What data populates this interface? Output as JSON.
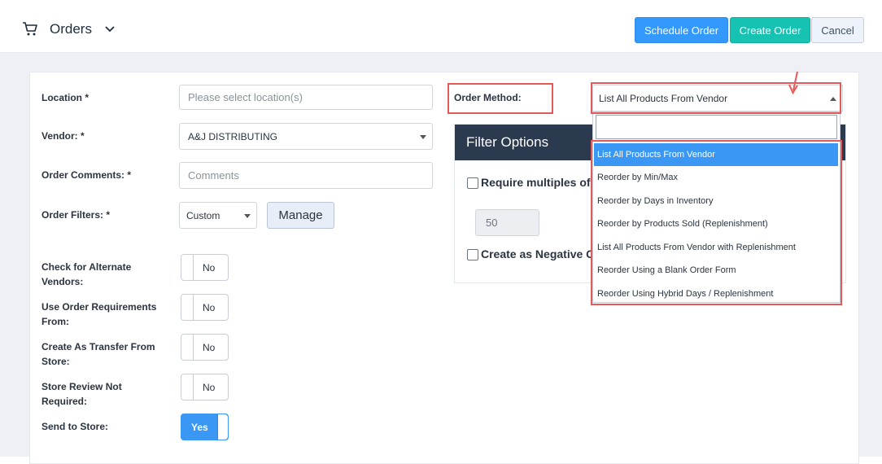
{
  "header": {
    "icon": "cart-icon",
    "title": "Orders",
    "chevron_icon": "chevron-down-icon",
    "buttons": {
      "schedule": "Schedule Order",
      "create": "Create Order",
      "cancel": "Cancel"
    },
    "colors": {
      "schedule": "#3399ff",
      "create": "#16c2b1"
    }
  },
  "form": {
    "location": {
      "label": "Location *",
      "placeholder": "Please select location(s)"
    },
    "vendor": {
      "label": "Vendor: *",
      "value": "A&J DISTRIBUTING"
    },
    "comments": {
      "label": "Order Comments: *",
      "placeholder": "Comments"
    },
    "filters": {
      "label": "Order Filters: *",
      "value": "Custom",
      "manage": "Manage"
    },
    "toggles": [
      {
        "label_1": "Check for Alternate",
        "label_2": "Vendors:",
        "value": "No"
      },
      {
        "label_1": "Use Order Requirements",
        "label_2": "From:",
        "value": "No"
      },
      {
        "label_1": "Create As Transfer From",
        "label_2": "Store:",
        "value": "No"
      },
      {
        "label_1": "Store Review Not",
        "label_2": "Required:",
        "value": "No"
      },
      {
        "label_1": "Send to Store:",
        "label_2": "",
        "value": "Yes"
      }
    ]
  },
  "order_method": {
    "label": "Order Method:",
    "selected": "List All Products From Vendor",
    "options": [
      "List All Products From Vendor",
      "Reorder by Min/Max",
      "Reorder by Days in Inventory",
      "Reorder by Products Sold (Replenishment)",
      "List All Products From Vendor with Replenishment",
      "Reorder Using a Blank Order Form",
      "Reorder Using Hybrid Days / Replenishment"
    ]
  },
  "filter_options": {
    "title": "Filter Options",
    "require_multiples": "Require multiples of",
    "multiple_value": "50",
    "create_negative": "Create as Negative C"
  },
  "annotation_color": "#e25a5a"
}
